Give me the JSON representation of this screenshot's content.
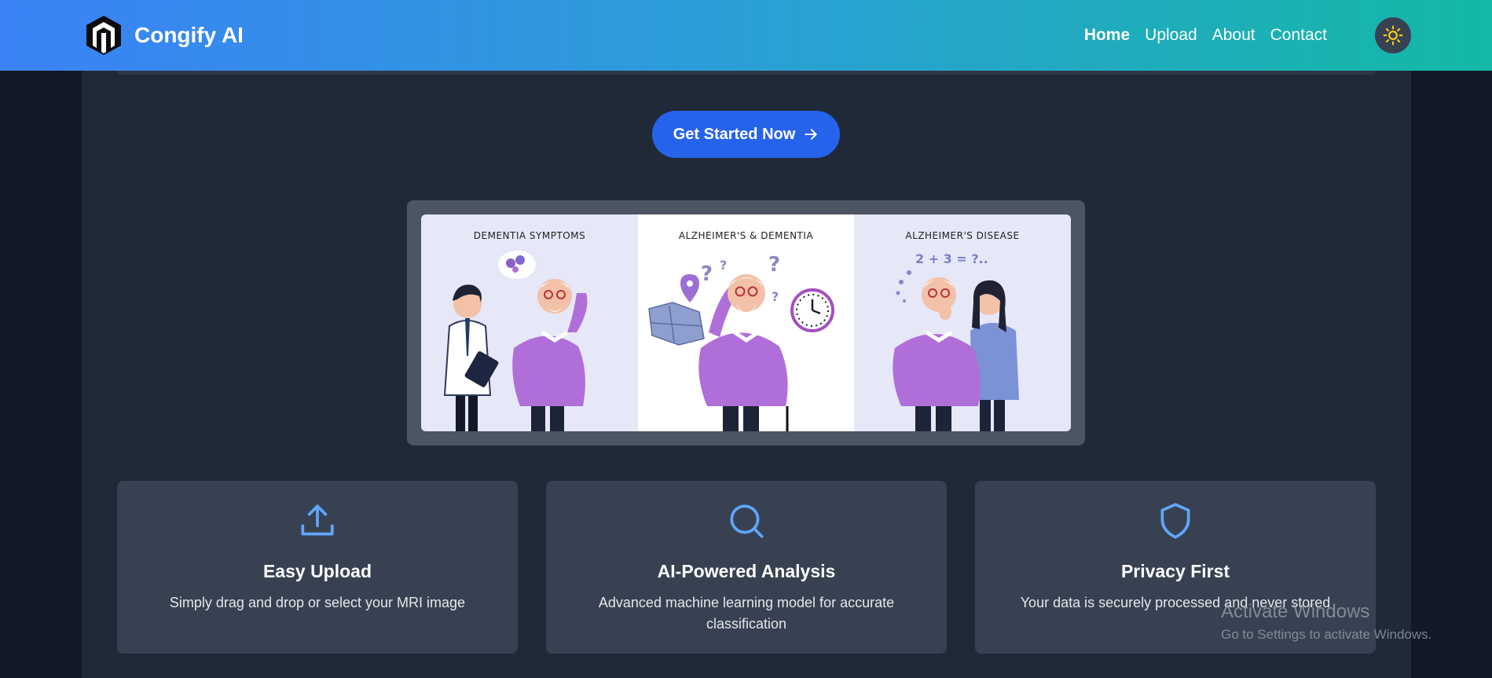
{
  "header": {
    "brand": "Congify AI",
    "nav": [
      {
        "label": "Home",
        "active": true
      },
      {
        "label": "Upload",
        "active": false
      },
      {
        "label": "About",
        "active": false
      },
      {
        "label": "Contact",
        "active": false
      }
    ],
    "theme_icon": "sun-icon"
  },
  "hero": {
    "cta_label": "Get Started Now",
    "cta_icon": "arrow-right-icon"
  },
  "illustration": {
    "panels": [
      {
        "title": "DEMENTIA SYMPTOMS"
      },
      {
        "title": "ALZHEIMER'S & DEMENTIA"
      },
      {
        "title": "ALZHEIMER'S DISEASE"
      }
    ],
    "math_text": "2 + 3 = ?.."
  },
  "features": [
    {
      "icon": "upload-icon",
      "title": "Easy Upload",
      "description": "Simply drag and drop or select your MRI image"
    },
    {
      "icon": "search-icon",
      "title": "AI-Powered Analysis",
      "description": "Advanced machine learning model for accurate classification"
    },
    {
      "icon": "shield-icon",
      "title": "Privacy First",
      "description": "Your data is securely processed and never stored"
    }
  ],
  "watermark": {
    "title": "Activate Windows",
    "subtitle": "Go to Settings to activate Windows."
  },
  "colors": {
    "nav_gradient_start": "#3b82f6",
    "nav_gradient_end": "#14b8a6",
    "page_bg": "#111827",
    "container_bg": "#1f2937",
    "card_bg": "#374151",
    "cta_bg": "#2563eb",
    "icon_accent": "#60a5fa",
    "sun_color": "#facc15"
  }
}
